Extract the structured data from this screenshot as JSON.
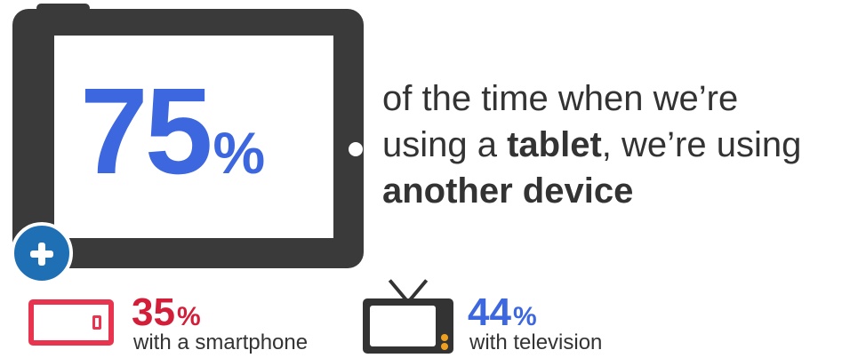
{
  "hero": {
    "stat_number": "75",
    "stat_percent": "%",
    "text_line1": "of the time when we’re",
    "text_line2_pre": "using a ",
    "text_line2_bold": "tablet",
    "text_line2_post": ", we’re using",
    "text_line3_bold": "another device"
  },
  "smartphone": {
    "number": "35",
    "percent": "%",
    "caption": "with a smartphone"
  },
  "television": {
    "number": "44",
    "percent": "%",
    "caption": "with television"
  },
  "icons": [
    "tablet-icon",
    "plus-icon",
    "smartphone-icon",
    "television-icon"
  ],
  "colors": {
    "blue": "#3d67de",
    "red": "#d31e3a",
    "dark": "#3a3a3a",
    "badge": "#1f6fb5"
  }
}
